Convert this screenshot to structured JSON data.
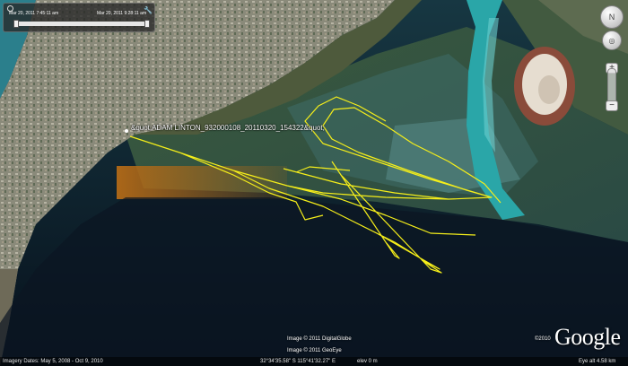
{
  "timeSlider": {
    "start": "Mar 20, 2011  7:45:11 am",
    "end": "Mar 20, 2011  9:28:11 am",
    "position": 1.0
  },
  "placemark": {
    "label": "&quot;ADAM LINTON_932000108_20110320_154322&quot;"
  },
  "credits": {
    "line1": "Image © 2011 DigitalGlobe",
    "line2": "Image © 2011 GeoEye",
    "copyright": "©2010",
    "logo": "Google"
  },
  "statusBar": {
    "imageryDates": "Imagery Dates: May 5, 2008 - Oct 9, 2010",
    "coords": "32°34'35.58\" S    115°41'32.27\" E",
    "elev": "elev    0 m",
    "eyeAlt": "Eye alt    4.58 km"
  },
  "icons": {
    "compass": "compass-icon",
    "look": "look-joystick-icon",
    "move": "move-joystick-icon",
    "zoomIn": "plus-icon",
    "zoomOut": "minus-icon",
    "settings": "wrench-icon",
    "clock": "clock-icon"
  },
  "colors": {
    "track": "#f5ee1a",
    "sea": "#0e1a26",
    "shallows": "#2f4a3a",
    "channel": "#2aa6a8",
    "land": "#7a7a68",
    "gradientShadow": "#b36a17"
  }
}
